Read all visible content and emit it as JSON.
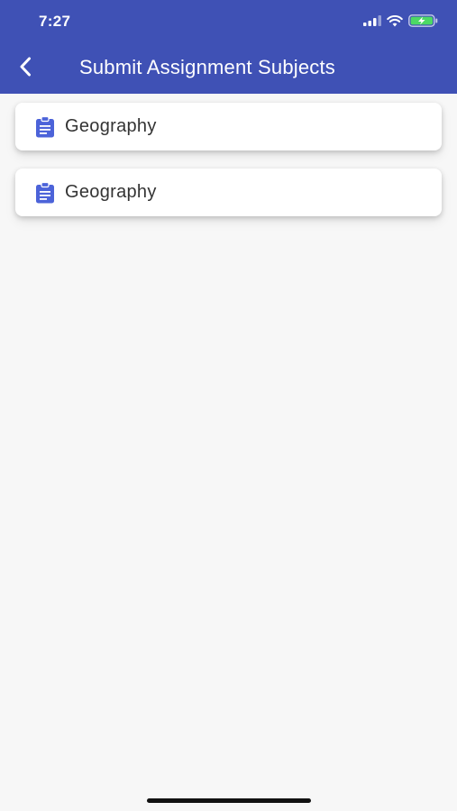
{
  "status_bar": {
    "time": "7:27",
    "icons": [
      "signal-icon",
      "wifi-icon",
      "battery-charging-icon"
    ]
  },
  "header": {
    "title": "Submit Assignment Subjects",
    "back_icon": "chevron-left-icon",
    "background_color": "#3f51b5"
  },
  "subjects": [
    {
      "label": "Geography",
      "icon": "clipboard-icon"
    },
    {
      "label": "Geography",
      "icon": "clipboard-icon"
    }
  ],
  "colors": {
    "accent": "#3f51b5",
    "icon": "#4c63d9",
    "battery": "#4cd964"
  }
}
